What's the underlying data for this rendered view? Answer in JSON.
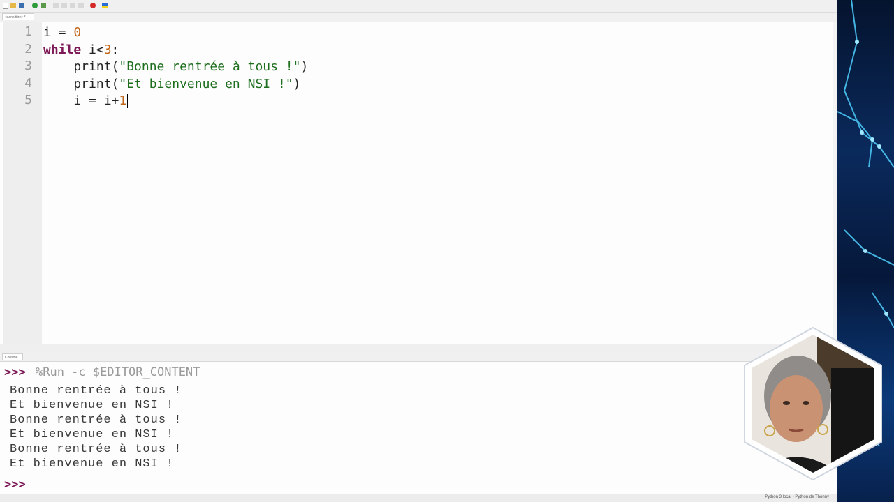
{
  "editor": {
    "tab_label": "<sans titre> *",
    "line_numbers": [
      "1",
      "2",
      "3",
      "4",
      "5"
    ],
    "lines": [
      [
        {
          "t": "i = ",
          "c": "plain"
        },
        {
          "t": "0",
          "c": "num"
        }
      ],
      [
        {
          "t": "while",
          "c": "kw"
        },
        {
          "t": " i<",
          "c": "plain"
        },
        {
          "t": "3",
          "c": "num"
        },
        {
          "t": ":",
          "c": "plain"
        }
      ],
      [
        {
          "t": "    print(",
          "c": "plain"
        },
        {
          "t": "\"Bonne rentrée à tous !\"",
          "c": "str"
        },
        {
          "t": ")",
          "c": "plain"
        }
      ],
      [
        {
          "t": "    print(",
          "c": "plain"
        },
        {
          "t": "\"Et bienvenue en NSI !\"",
          "c": "str"
        },
        {
          "t": ")",
          "c": "plain"
        }
      ],
      [
        {
          "t": "    i = i+",
          "c": "plain"
        },
        {
          "t": "1",
          "c": "num"
        }
      ]
    ]
  },
  "console": {
    "tab_label": "Console",
    "prompt": ">>>",
    "command": "%Run -c $EDITOR_CONTENT",
    "output": [
      "Bonne rentrée à tous !",
      "Et bienvenue en NSI !",
      "Bonne rentrée à tous !",
      "Et bienvenue en NSI !",
      "Bonne rentrée à tous !",
      "Et bienvenue en NSI !"
    ]
  },
  "statusbar": {
    "text": "Python 3 local • Python de Thonny"
  },
  "toolbar": {
    "icons": [
      "new-file-icon",
      "open-file-icon",
      "save-icon",
      "run-icon",
      "debug-icon",
      "step-over-icon",
      "step-into-icon",
      "step-out-icon",
      "resume-icon",
      "stop-icon",
      "flag-icon"
    ]
  },
  "colors": {
    "keyword": "#7d1a57",
    "number": "#c0661a",
    "string": "#1d6e1d",
    "prompt": "#7d1a57"
  }
}
